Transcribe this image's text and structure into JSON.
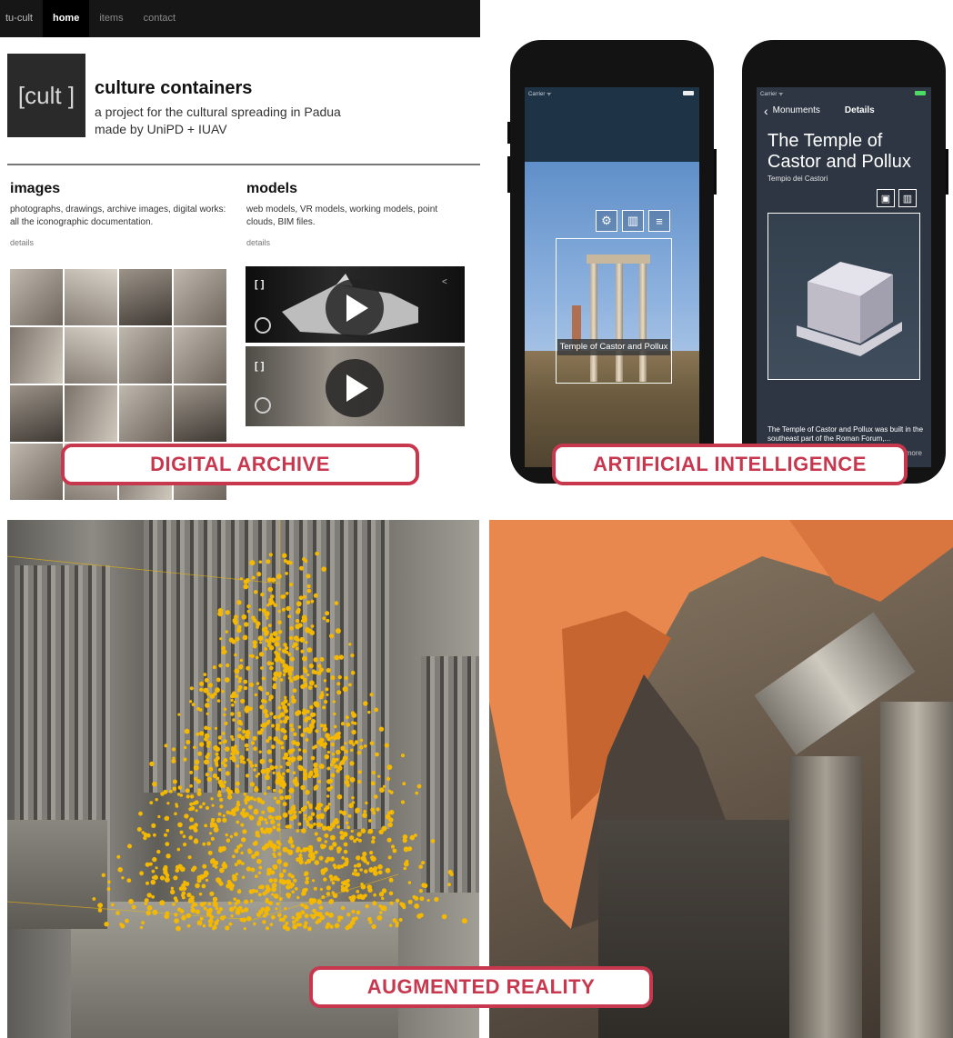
{
  "nav": {
    "brand": "tu-cult",
    "items": [
      "home",
      "items",
      "contact"
    ]
  },
  "site": {
    "logo": "[cult ]",
    "title": "culture containers",
    "subtitle_line1": "a project for the cultural spreading in Padua",
    "subtitle_line2": "made by UniPD + IUAV"
  },
  "images_section": {
    "title": "images",
    "description": "photographs, drawings, archive images, digital works: all the iconographic documentation.",
    "link": "details"
  },
  "models_section": {
    "title": "models",
    "description": "web models, VR models, working models, point clouds, BIM files.",
    "link": "details"
  },
  "phone1": {
    "carrier": "Carrier",
    "caption": "Temple of Castor and Pollux"
  },
  "phone2": {
    "carrier": "Carrier",
    "back": "Monuments",
    "nav_title": "Details",
    "title": "The Temple of Castor and Pollux",
    "subtitle": "Tempio dei Castori",
    "description": "The Temple of Castor and Pollux was built in the southeast part of the Roman Forum,...",
    "more": "more"
  },
  "labels": {
    "archive": "DIGITAL ARCHIVE",
    "ai": "ARTIFICIAL INTELLIGENCE",
    "ar": "AUGMENTED REALITY"
  },
  "colors": {
    "label_accent": "#c7384f",
    "point_cloud": "#f5b800",
    "overlay_orange": "#e8874e"
  }
}
